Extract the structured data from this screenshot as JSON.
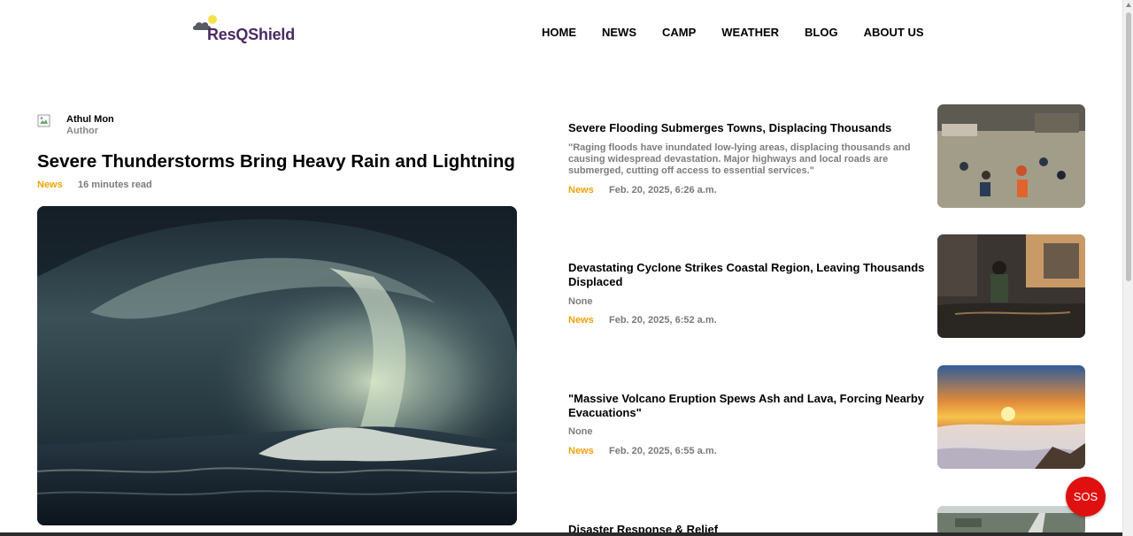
{
  "brand": {
    "name": "ResQShield"
  },
  "nav": {
    "items": [
      {
        "label": "HOME"
      },
      {
        "label": "NEWS"
      },
      {
        "label": "CAMP"
      },
      {
        "label": "WEATHER"
      },
      {
        "label": "BLOG"
      },
      {
        "label": "ABOUT US"
      }
    ]
  },
  "main_article": {
    "author_name": "Athul Mon",
    "author_role": "Author",
    "title": "Severe Thunderstorms Bring Heavy Rain and Lightning",
    "category": "News",
    "read_time": "16 minutes read"
  },
  "side_articles": [
    {
      "title": "Severe Flooding Submerges Towns, Displacing Thousands",
      "excerpt": "\"Raging floods have inundated low-lying areas, displacing thousands and causing widespread devastation. Major highways and local roads are submerged, cutting off access to essential services.\"",
      "category": "News",
      "date": "Feb. 20, 2025, 6:26 a.m."
    },
    {
      "title": "Devastating Cyclone Strikes Coastal Region, Leaving Thousands Displaced",
      "excerpt": "None",
      "category": "News",
      "date": "Feb. 20, 2025, 6:52 a.m."
    },
    {
      "title": "\"Massive Volcano Eruption Spews Ash and Lava, Forcing Nearby Evacuations\"",
      "excerpt": "None",
      "category": "News",
      "date": "Feb. 20, 2025, 6:55 a.m."
    },
    {
      "title": "Disaster Response & Relief"
    }
  ],
  "sos": {
    "label": "SOS"
  },
  "colors": {
    "accent": "#f2a20c",
    "brand": "#4a2a63",
    "sos": "#e01010"
  }
}
